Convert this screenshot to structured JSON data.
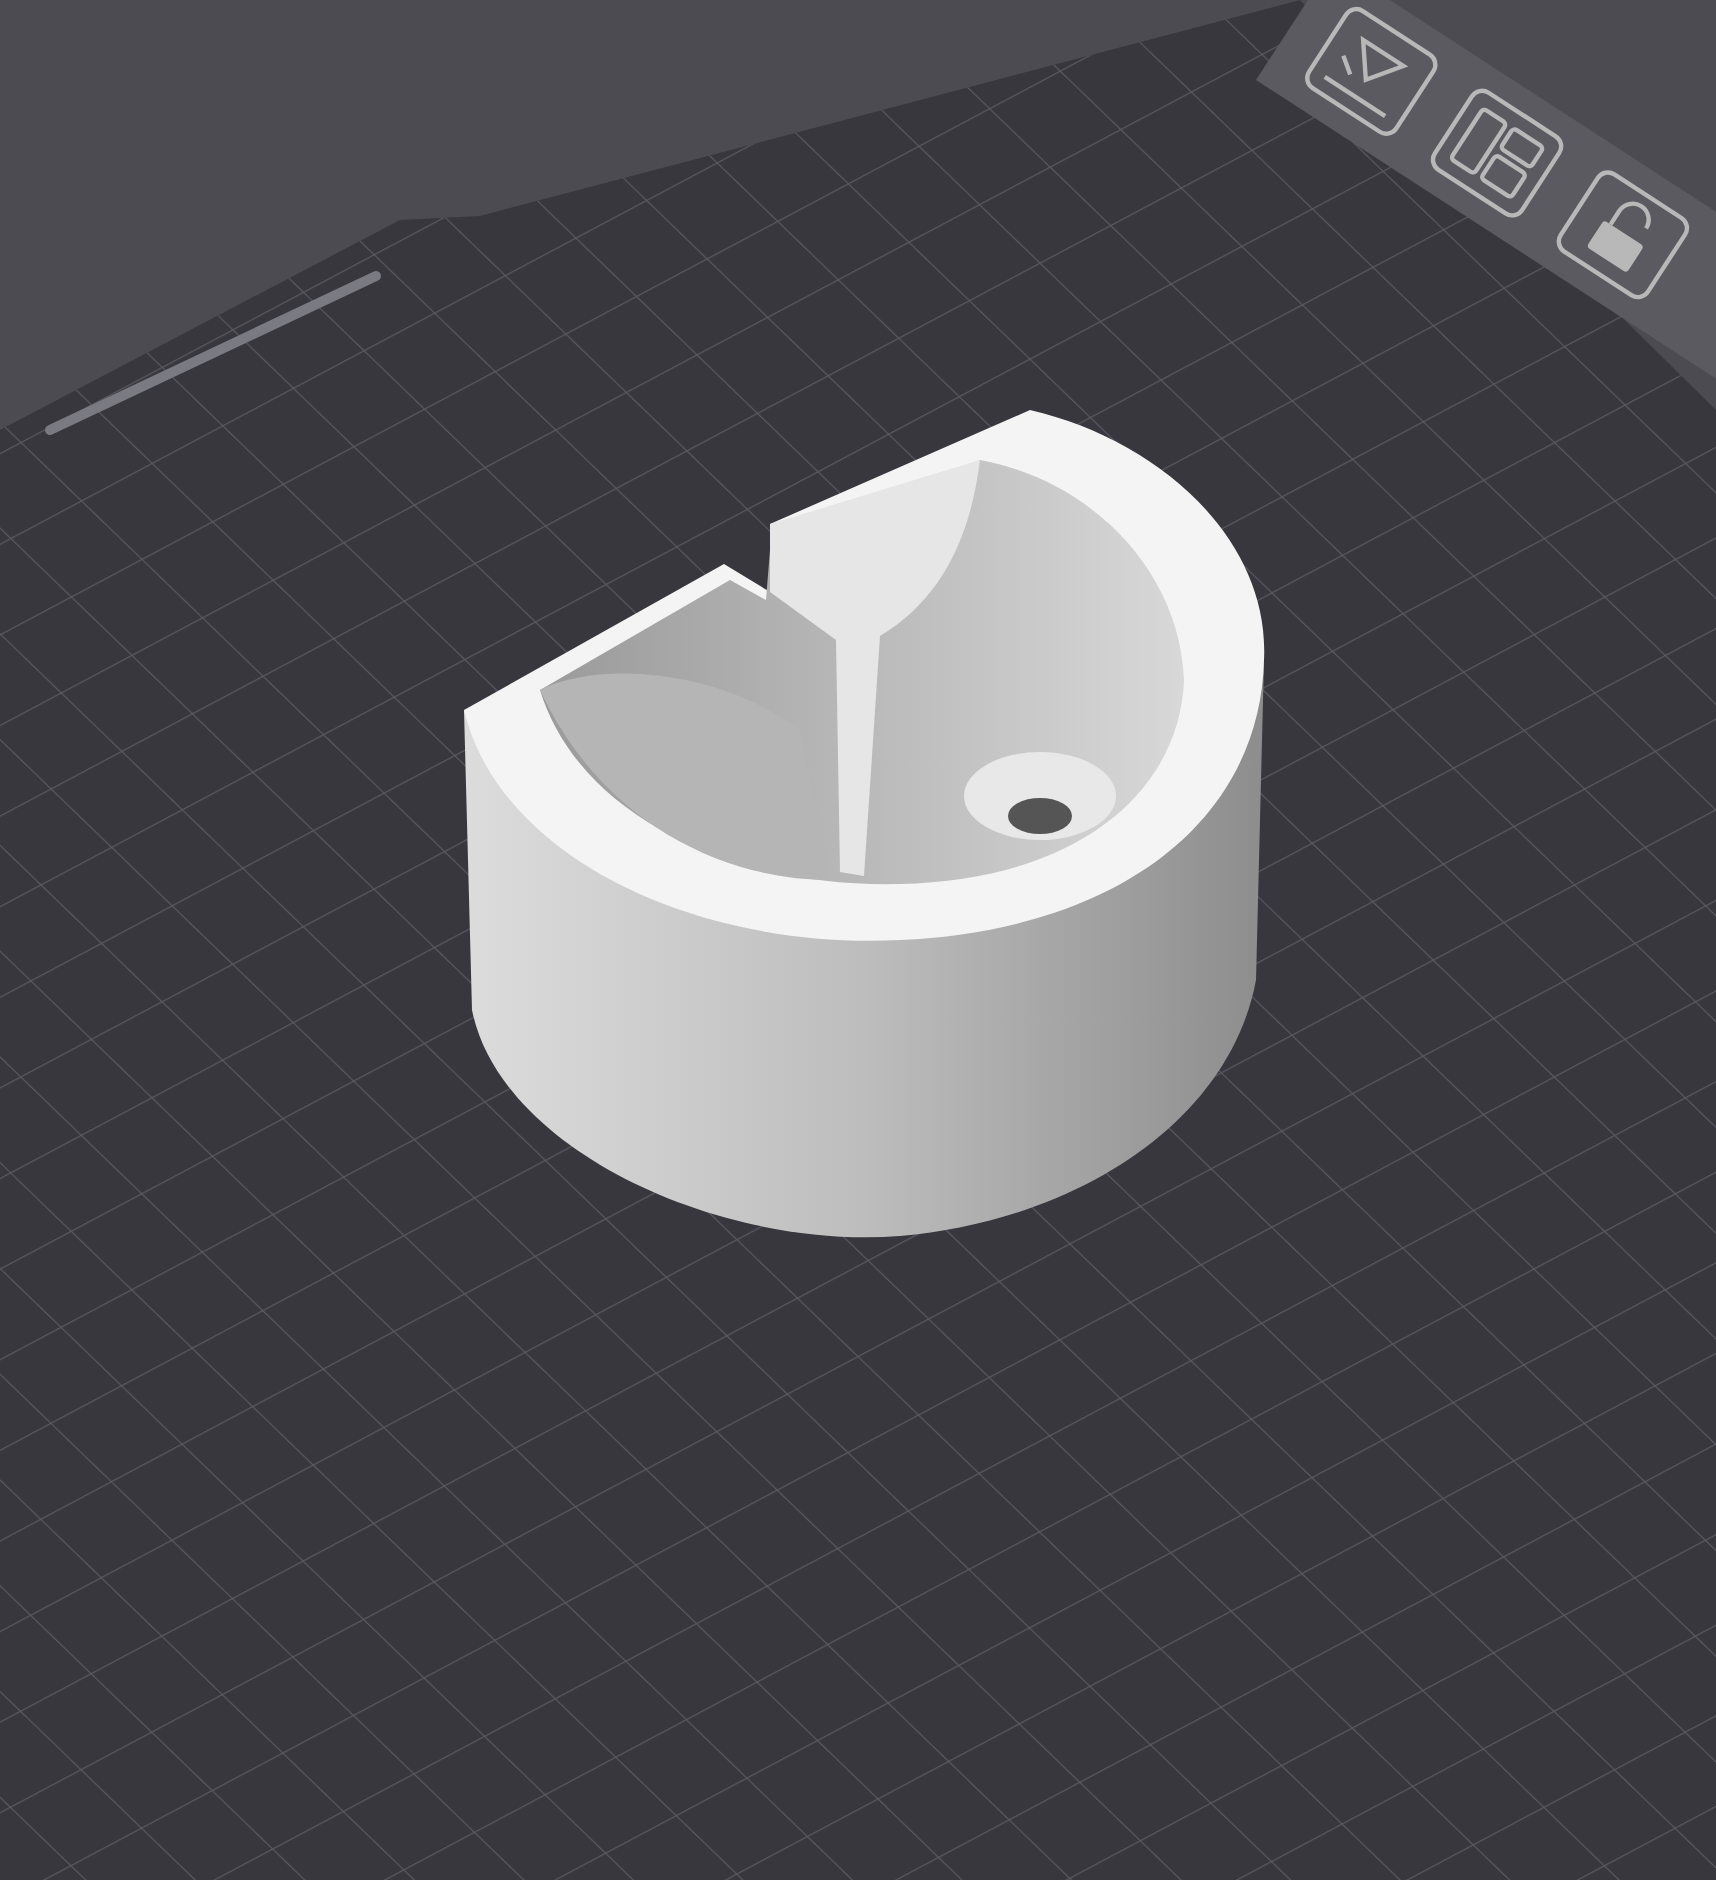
{
  "viewport": {
    "kind": "plate"
  },
  "toolbar": [
    {
      "kind": "auto-orient"
    },
    {
      "kind": "arrange"
    },
    {
      "kind": "lock",
      "locked": false
    }
  ]
}
